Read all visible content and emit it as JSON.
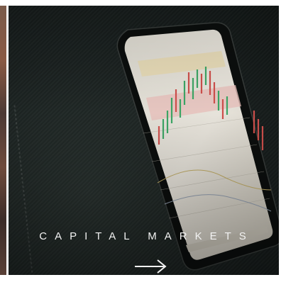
{
  "tile": {
    "title": "CAPITAL MARKETS",
    "arrow_icon": "arrow-right-icon"
  },
  "colors": {
    "background": "#1b2221",
    "text": "#f2f2f2",
    "candle_up": "#3fae6a",
    "candle_down": "#d9534f"
  }
}
